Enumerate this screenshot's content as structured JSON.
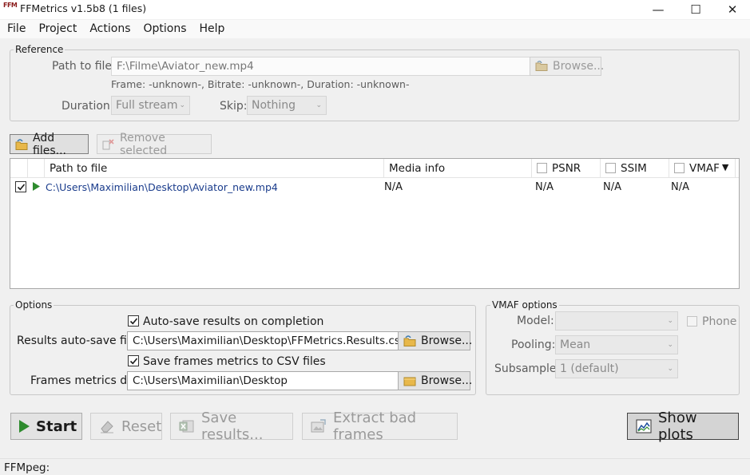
{
  "window": {
    "app_icon_text": "FFM",
    "title": "FFMetrics v1.5b8 (1 files)",
    "minimize_glyph": "—",
    "maximize_glyph": "☐",
    "close_glyph": "✕"
  },
  "menu": [
    "File",
    "Project",
    "Actions",
    "Options",
    "Help"
  ],
  "reference": {
    "legend": "Reference",
    "path_label": "Path to file:",
    "path_value": "F:\\Filme\\Aviator_new.mp4",
    "browse_label": "Browse...",
    "info": "Frame: -unknown-, Bitrate: -unknown-, Duration: -unknown-",
    "duration_label": "Duration:",
    "duration_value": "Full stream",
    "skip_label": "Skip:",
    "skip_value": "Nothing"
  },
  "file_toolbar": {
    "add_label": "Add files...",
    "remove_label": "Remove selected"
  },
  "file_list": {
    "columns": {
      "path": "Path to file",
      "media": "Media info",
      "psnr": "PSNR",
      "ssim": "SSIM",
      "vmaf": "VMAF",
      "sort_glyph": "▼"
    },
    "rows": [
      {
        "checked": true,
        "path": "C:\\Users\\Maximilian\\Desktop\\Aviator_new.mp4",
        "media": "N/A",
        "psnr": "N/A",
        "ssim": "N/A",
        "vmaf": "N/A"
      }
    ]
  },
  "options": {
    "legend": "Options",
    "autosave_label": "Auto-save results on completion",
    "autosave_checked": true,
    "results_file_label": "Results auto-save file:",
    "results_file_value": "C:\\Users\\Maximilian\\Desktop\\FFMetrics.Results.csv",
    "browse_label": "Browse...",
    "save_frames_label": "Save frames metrics to CSV files",
    "save_frames_checked": true,
    "frames_dir_label": "Frames metrics dir:",
    "frames_dir_value": "C:\\Users\\Maximilian\\Desktop",
    "browse2_label": "Browse..."
  },
  "vmaf_options": {
    "legend": "VMAF options",
    "model_label": "Model:",
    "model_value": "",
    "phone_label": "Phone",
    "pooling_label": "Pooling:",
    "pooling_value": "Mean",
    "subsample_label": "Subsample:",
    "subsample_value": "1 (default)"
  },
  "actions": {
    "start_label": "Start",
    "reset_label": "Reset",
    "save_label": "Save results...",
    "extract_label": "Extract bad frames",
    "plots_label": "Show plots"
  },
  "status": {
    "ffmpeg_label": "FFMpeg:"
  },
  "colors": {
    "accent_green": "#2e8b2e",
    "link_blue": "#1a3c8c",
    "folder_yellow": "#e8b84a"
  }
}
